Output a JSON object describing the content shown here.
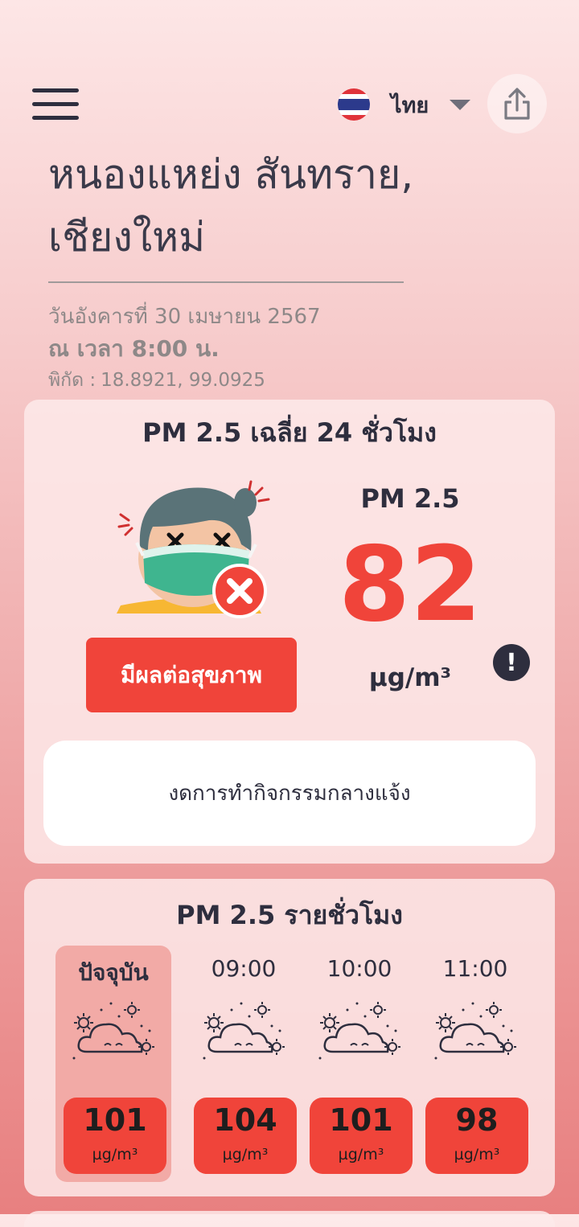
{
  "header": {
    "language": "ไทย",
    "menu_icon": "hamburger-menu-icon",
    "share_icon": "share-icon",
    "flag_icon": "thai-flag-icon"
  },
  "location": {
    "line1": "หนองแหย่ง สันทราย,",
    "line2": "เชียงใหม่",
    "date": "วันอังคารที่ 30 เมษายน 2567",
    "time": "ณ เวลา 8:00 น.",
    "coord_label": "พิกัด :",
    "coord_value": "18.8921, 99.0925"
  },
  "current": {
    "title": "PM 2.5 เฉลี่ย 24 ชั่วโมง",
    "pm_label": "PM 2.5",
    "value": "82",
    "unit": "µg/m³",
    "status": "มีผลต่อสุขภาพ",
    "advice": "งดการทำกิจกรรมกลางแจ้ง",
    "info_icon": "info-icon",
    "status_color": "#f0443a"
  },
  "hourly": {
    "title": "PM 2.5 รายชั่วโมง",
    "items": [
      {
        "label": "ปัจจุบัน",
        "value": "101",
        "unit": "µg/m³"
      },
      {
        "label": "09:00",
        "value": "104",
        "unit": "µg/m³"
      },
      {
        "label": "10:00",
        "value": "101",
        "unit": "µg/m³"
      },
      {
        "label": "11:00",
        "value": "98",
        "unit": "µg/m³"
      }
    ]
  }
}
